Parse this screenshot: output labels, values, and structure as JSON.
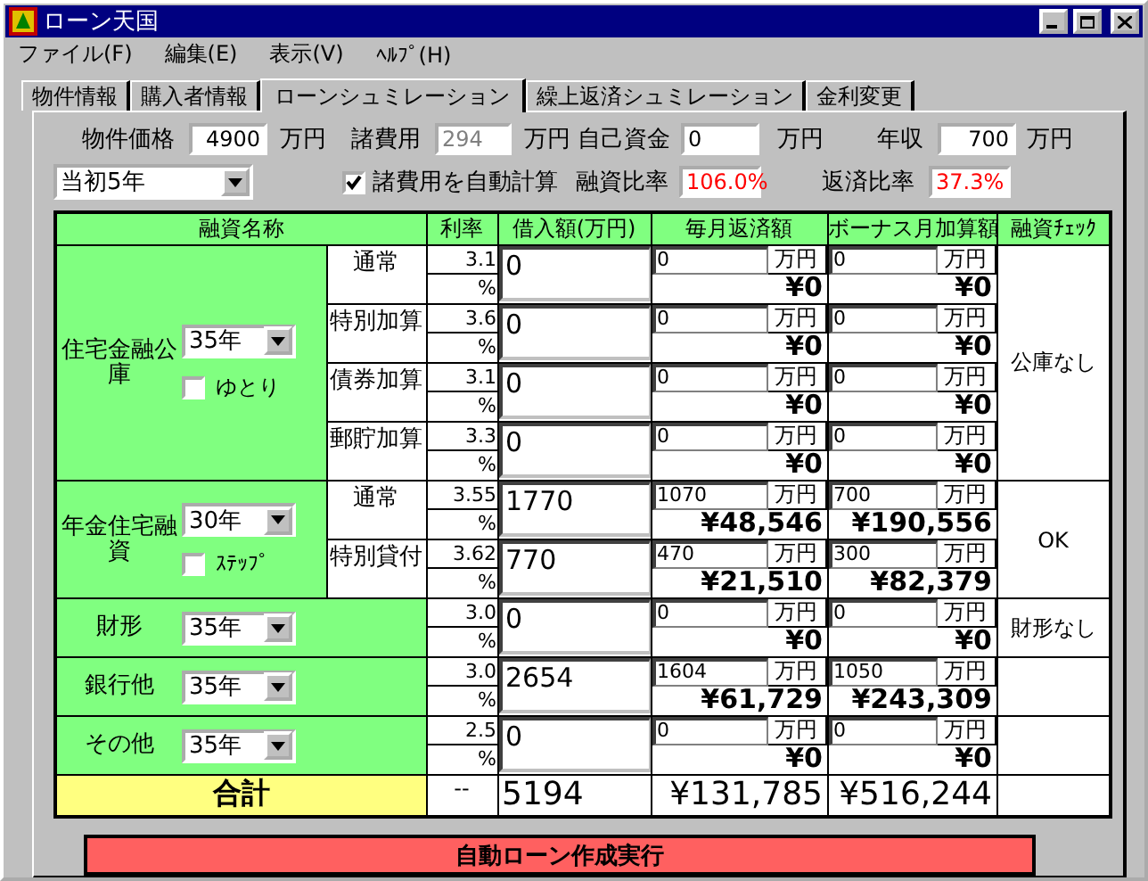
{
  "window": {
    "title": "ローン天国"
  },
  "menu": [
    "ファイル(F)",
    "編集(E)",
    "表示(V)",
    "ﾍﾙﾌﾟ(H)"
  ],
  "tabs": [
    {
      "label": "物件情報",
      "selected": false
    },
    {
      "label": "購入者情報",
      "selected": false
    },
    {
      "label": "ローンシュミレーション",
      "selected": true
    },
    {
      "label": "繰上返済シュミレーション",
      "selected": false
    },
    {
      "label": "金利変更",
      "selected": false
    }
  ],
  "property_price": {
    "label": "物件価格",
    "value": "4900",
    "unit": "万円"
  },
  "fees": {
    "label": "諸費用",
    "value": "294",
    "unit": "万円",
    "disabled": true
  },
  "own_funds": {
    "label": "自己資金",
    "value": "0",
    "unit": "万円"
  },
  "annual_income": {
    "label": "年収",
    "value": "700",
    "unit": "万円"
  },
  "period_select": {
    "value": "当初5年"
  },
  "auto_fees": {
    "label": "諸費用を自動計算",
    "checked": true
  },
  "loan_ratio": {
    "label": "融資比率",
    "value": "106.0%"
  },
  "repay_ratio": {
    "label": "返済比率",
    "value": "37.3%"
  },
  "table": {
    "columns": [
      "融資名称",
      "利率",
      "借入額(万円)",
      "毎月返済額",
      "ボーナス月加算額",
      "融資ﾁｪｯｸ"
    ],
    "groups": [
      {
        "name": "住宅金融公庫",
        "term": "35年",
        "option": {
          "label": "ゆとり",
          "checked": false
        },
        "check": "公庫なし",
        "lines": [
          {
            "label": "通常",
            "rate": "3.1",
            "rate_unit": "%",
            "amount": "0",
            "monthly": "0",
            "monthly_unit": "万円",
            "monthly_yen": "¥0",
            "bonus": "0",
            "bonus_unit": "万円",
            "bonus_yen": "¥0"
          },
          {
            "label": "特別加算",
            "rate": "3.6",
            "rate_unit": "%",
            "amount": "0",
            "monthly": "0",
            "monthly_unit": "万円",
            "monthly_yen": "¥0",
            "bonus": "0",
            "bonus_unit": "万円",
            "bonus_yen": "¥0"
          },
          {
            "label": "債券加算",
            "rate": "3.1",
            "rate_unit": "%",
            "amount": "0",
            "monthly": "0",
            "monthly_unit": "万円",
            "monthly_yen": "¥0",
            "bonus": "0",
            "bonus_unit": "万円",
            "bonus_yen": "¥0"
          },
          {
            "label": "郵貯加算",
            "rate": "3.3",
            "rate_unit": "%",
            "amount": "0",
            "monthly": "0",
            "monthly_unit": "万円",
            "monthly_yen": "¥0",
            "bonus": "0",
            "bonus_unit": "万円",
            "bonus_yen": "¥0"
          }
        ]
      },
      {
        "name": "年金住宅融資",
        "term": "30年",
        "option": {
          "label": "ｽﾃｯﾌﾟ",
          "checked": false
        },
        "check": "OK",
        "lines": [
          {
            "label": "通常",
            "rate": "3.55",
            "rate_unit": "%",
            "amount": "1770",
            "monthly": "1070",
            "monthly_unit": "万円",
            "monthly_yen": "¥48,546",
            "bonus": "700",
            "bonus_unit": "万円",
            "bonus_yen": "¥190,556"
          },
          {
            "label": "特別貸付",
            "rate": "3.62",
            "rate_unit": "%",
            "amount": "770",
            "monthly": "470",
            "monthly_unit": "万円",
            "monthly_yen": "¥21,510",
            "bonus": "300",
            "bonus_unit": "万円",
            "bonus_yen": "¥82,379"
          }
        ]
      },
      {
        "name": "財形",
        "term": "35年",
        "check": "財形なし",
        "lines": [
          {
            "rate": "3.0",
            "rate_unit": "%",
            "amount": "0",
            "monthly": "0",
            "monthly_unit": "万円",
            "monthly_yen": "¥0",
            "bonus": "0",
            "bonus_unit": "万円",
            "bonus_yen": "¥0"
          }
        ]
      },
      {
        "name": "銀行他",
        "term": "35年",
        "lines": [
          {
            "rate": "3.0",
            "rate_unit": "%",
            "amount": "2654",
            "monthly": "1604",
            "monthly_unit": "万円",
            "monthly_yen": "¥61,729",
            "bonus": "1050",
            "bonus_unit": "万円",
            "bonus_yen": "¥243,309"
          }
        ]
      },
      {
        "name": "その他",
        "term": "35年",
        "lines": [
          {
            "rate": "2.5",
            "rate_unit": "%",
            "amount": "0",
            "monthly": "0",
            "monthly_unit": "万円",
            "monthly_yen": "¥0",
            "bonus": "0",
            "bonus_unit": "万円",
            "bonus_yen": "¥0"
          }
        ]
      }
    ],
    "total": {
      "label": "合計",
      "rate": "--",
      "amount": "5194",
      "monthly": "¥131,785",
      "bonus": "¥516,244"
    }
  },
  "action_button": "自動ローン作成実行"
}
